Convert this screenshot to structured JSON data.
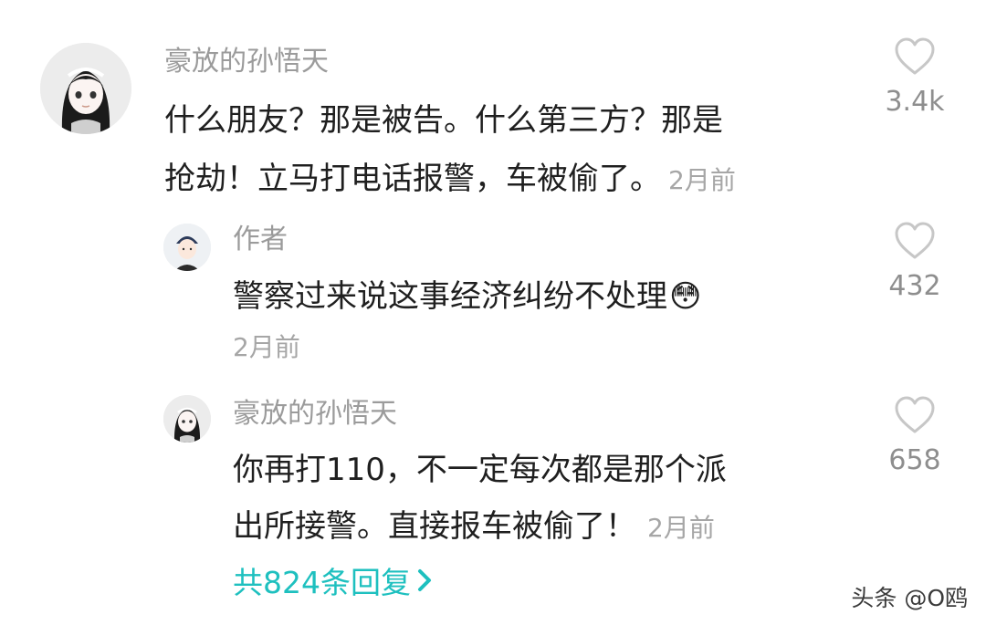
{
  "comment": {
    "username": "豪放的孙悟天",
    "text_line1": "什么朋友？那是被告。什么第三方？那是",
    "text_line2": "抢劫！立马打电话报警，车被偷了。",
    "time": "2月前",
    "likes": "3.4k"
  },
  "replies": [
    {
      "username": "作者",
      "text_line1": "警察过来说这事经济纠纷不处理",
      "emoji": "😳",
      "time": "2月前",
      "likes": "432"
    },
    {
      "username": "豪放的孙悟天",
      "text_line1": "你再打110，不一定每次都是那个派",
      "text_line2": "出所接警。直接报车被偷了！",
      "time": "2月前",
      "likes": "658"
    }
  ],
  "replies_link": {
    "label": "共824条回复",
    "chevron": "chevron-right-icon"
  },
  "watermark": "头条 @O鸥",
  "colors": {
    "accent": "#1ec0bf",
    "username": "#9b9b9b",
    "text": "#1f1f1f",
    "meta": "#a6a6a6"
  },
  "icons": {
    "like": "heart-outline-icon"
  }
}
